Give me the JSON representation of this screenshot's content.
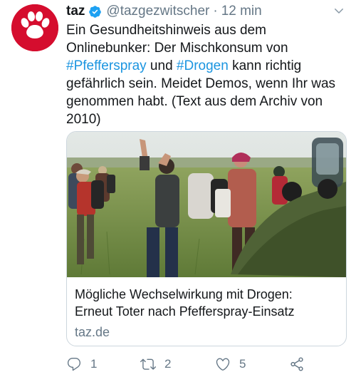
{
  "tweet": {
    "author_name": "taz",
    "handle": "@tazgezwitscher",
    "separator": "·",
    "time": "12 min",
    "text_lines": [
      [
        {
          "t": "Ein Gesundheitshinweis aus dem",
          "tag": false
        }
      ],
      [
        {
          "t": "Onlinebunker: Der Mischkonsum von",
          "tag": false
        }
      ],
      [
        {
          "t": "#Pfefferspray",
          "tag": true
        },
        {
          "t": " und ",
          "tag": false
        },
        {
          "t": "#Drogen",
          "tag": true
        },
        {
          "t": " kann richtig",
          "tag": false
        }
      ],
      [
        {
          "t": "gefährlich sein. Meidet Demos, wenn Ihr was",
          "tag": false
        }
      ],
      [
        {
          "t": "genommen habt. (Text aus dem Archiv von",
          "tag": false
        }
      ],
      [
        {
          "t": "2010)",
          "tag": false
        }
      ]
    ]
  },
  "card": {
    "title_lines": [
      "Mögliche Wechselwirkung mit Drogen:",
      "Erneut Toter nach Pfefferspray-Einsatz"
    ],
    "domain": "taz.de"
  },
  "actions": {
    "reply_count": "1",
    "retweet_count": "2",
    "like_count": "5"
  },
  "colors": {
    "brand_red": "#d50d2e",
    "link_blue": "#1b95e0",
    "muted": "#657786",
    "text": "#14171a",
    "verified_blue": "#1da1f2"
  },
  "icons": [
    "taz-paw-logo",
    "verified-badge-icon",
    "chevron-down-icon",
    "reply-icon",
    "retweet-icon",
    "like-icon",
    "share-icon"
  ]
}
